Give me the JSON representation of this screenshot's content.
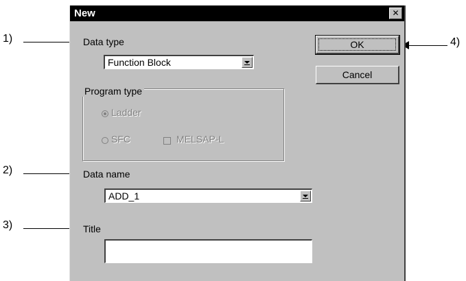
{
  "dialog": {
    "title": "New",
    "close_glyph": "✕"
  },
  "callouts": [
    "1)",
    "2)",
    "3)",
    "4)"
  ],
  "fields": {
    "data_type_label": "Data type",
    "data_type_value": "Function Block",
    "program_type_label": "Program type",
    "ladder_label": "Ladder",
    "sfc_label": "SFC",
    "melsap_label": "MELSAP-L",
    "data_name_label": "Data name",
    "data_name_value": "ADD_1",
    "title_label": "Title",
    "title_value": ""
  },
  "buttons": {
    "ok_label": "OK",
    "cancel_label": "Cancel"
  },
  "icons": [
    "close-icon",
    "dropdown-arrow-icon",
    "arrow-right-icon",
    "arrow-left-icon"
  ]
}
